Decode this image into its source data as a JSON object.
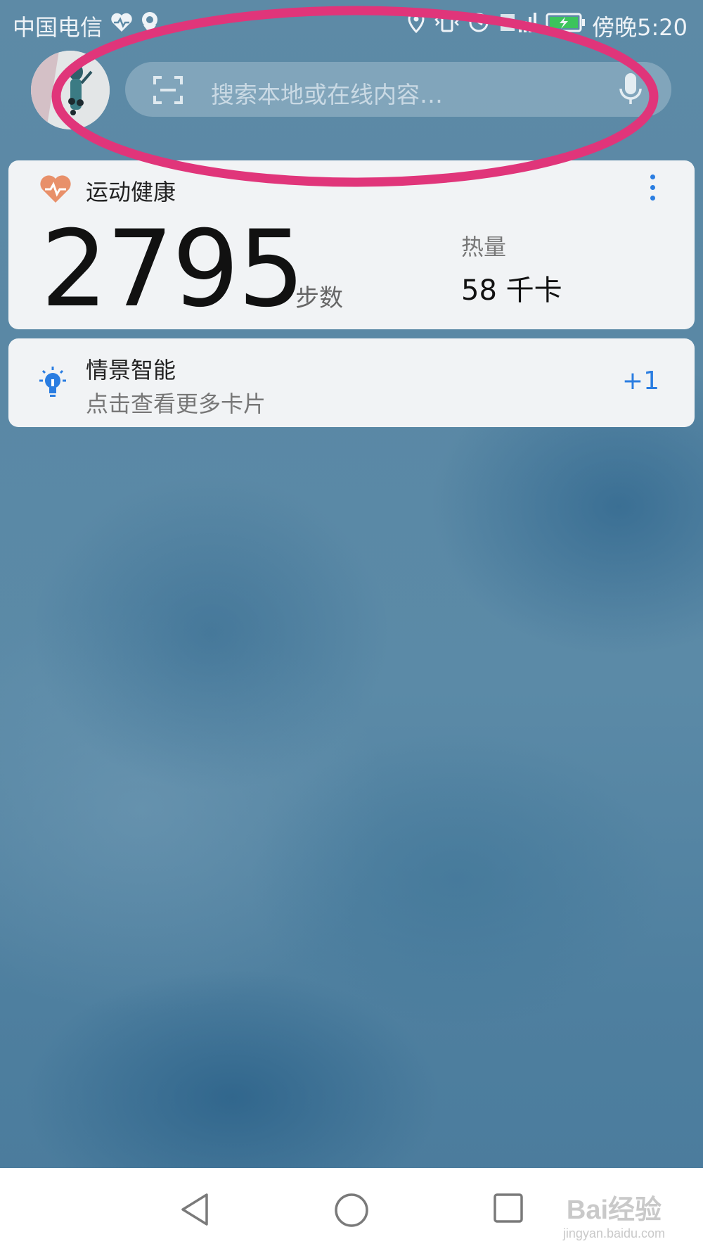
{
  "status_bar": {
    "carrier": "中国电信",
    "time": "傍晚5:20"
  },
  "search": {
    "placeholder": "搜索本地或在线内容…"
  },
  "health_card": {
    "title": "运动健康",
    "steps": "2795",
    "steps_unit": "步数",
    "calories_label": "热量",
    "calories_value": "58 千卡"
  },
  "scene_card": {
    "title": "情景智能",
    "subtitle": "点击查看更多卡片",
    "count": "+1"
  },
  "watermark": {
    "main": "Bai经验",
    "sub": "jingyan.baidu.com"
  },
  "colors": {
    "accent": "#2a7de1",
    "annotation": "#e0357a",
    "heart": "#e8906a"
  }
}
